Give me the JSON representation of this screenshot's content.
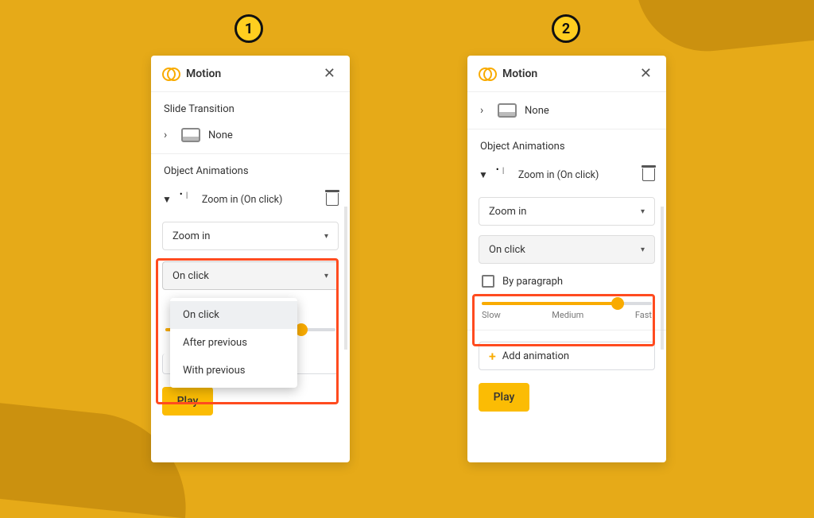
{
  "steps": {
    "one": "1",
    "two": "2"
  },
  "panel": {
    "title": "Motion",
    "slide_transition_label": "Slide Transition",
    "transition_value": "None",
    "object_animations_label": "Object Animations",
    "anim_summary": "Zoom in  (On click)",
    "anim_type": "Zoom in",
    "trigger_selected": "On click",
    "trigger_options": {
      "on_click": "On click",
      "after_previous": "After previous",
      "with_previous": "With previous"
    },
    "by_paragraph": "By paragraph",
    "speed": {
      "slow": "Slow",
      "medium": "Medium",
      "fast": "Fast",
      "value_pct": 78
    },
    "add_animation": "Add animation",
    "add_animation_clipped": "Add animation",
    "play": "Play"
  }
}
